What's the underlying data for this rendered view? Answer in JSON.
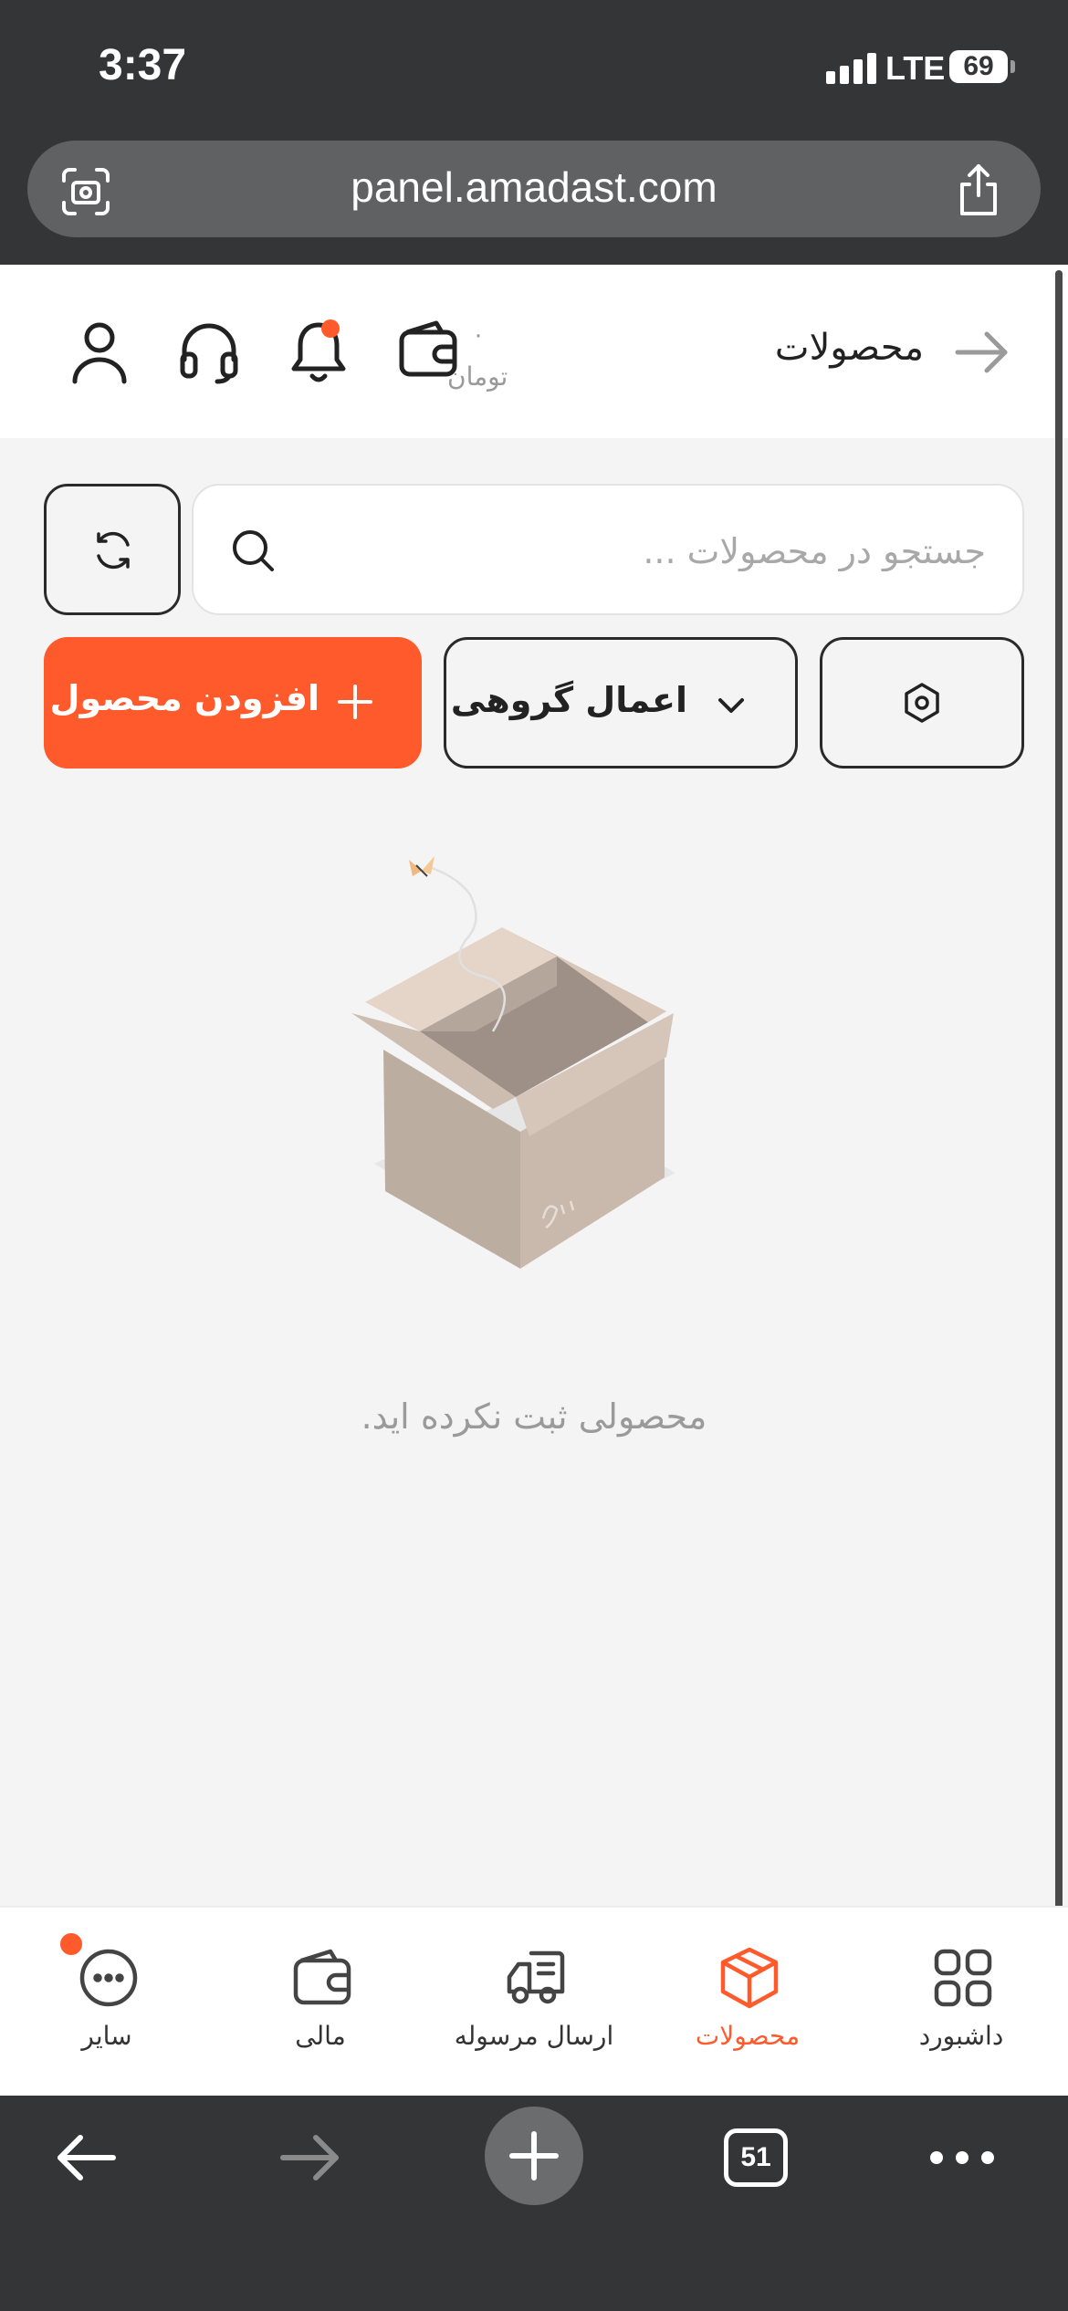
{
  "status_bar": {
    "time": "3:37",
    "network": "LTE",
    "battery": "69"
  },
  "browser": {
    "url": "panel.amadast.com",
    "tabs_count": "51",
    "page_load_progress": 0.9
  },
  "header": {
    "title": "محصولات",
    "balance_value": "۰",
    "balance_currency": "تومان",
    "icons": [
      "back-arrow-icon",
      "wallet-icon",
      "bell-icon",
      "headset-icon",
      "user-icon"
    ]
  },
  "search": {
    "placeholder": "جستجو در محصولات ..."
  },
  "actions": {
    "add_product": "افزودن محصول",
    "bulk_actions": "اعمال گروهی"
  },
  "empty_state": {
    "message": "محصولی ثبت نکرده اید."
  },
  "bottom_nav": {
    "items": [
      {
        "label": "داشبورد",
        "icon": "grid-icon",
        "active": false
      },
      {
        "label": "محصولات",
        "icon": "box-icon",
        "active": true
      },
      {
        "label": "ارسال مرسوله",
        "icon": "truck-icon",
        "active": false
      },
      {
        "label": "مالی",
        "icon": "wallet-icon",
        "active": false
      },
      {
        "label": "سایر",
        "icon": "more-icon",
        "active": false
      }
    ]
  },
  "colors": {
    "accent": "#ff5a2c",
    "page_bg": "#f4f4f4",
    "browser_chrome": "#333536"
  }
}
